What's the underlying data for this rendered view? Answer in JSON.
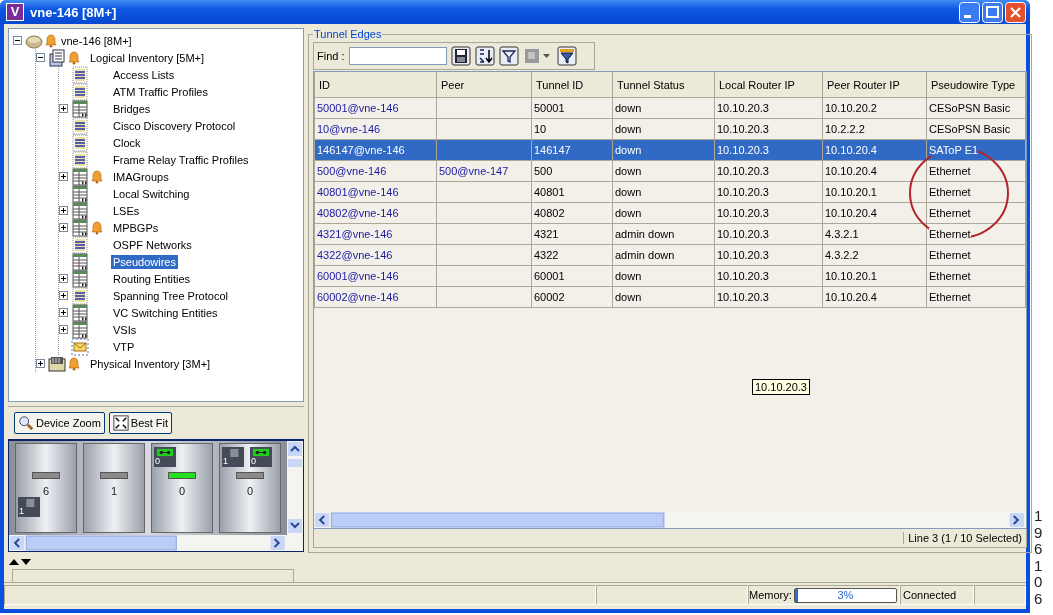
{
  "window": {
    "app_icon_letter": "V",
    "title": "vne-146 [8M+]"
  },
  "tree": [
    {
      "label": "vne-146 [8M+]",
      "kind": "device",
      "alarm": true,
      "expanded": true,
      "selected": false,
      "children": [
        {
          "label": "Logical Inventory [5M+]",
          "kind": "logical",
          "alarm": true,
          "expanded": true,
          "selected": false,
          "children": [
            {
              "label": "Access Lists",
              "kind": "list",
              "alarm": false,
              "selected": false
            },
            {
              "label": "ATM Traffic Profiles",
              "kind": "list",
              "alarm": false,
              "selected": false
            },
            {
              "label": "Bridges",
              "kind": "table",
              "alarm": false,
              "expanded": false,
              "selected": false
            },
            {
              "label": "Cisco Discovery Protocol",
              "kind": "list",
              "alarm": false,
              "selected": false
            },
            {
              "label": "Clock",
              "kind": "list",
              "alarm": false,
              "selected": false
            },
            {
              "label": "Frame Relay Traffic Profiles",
              "kind": "list",
              "alarm": false,
              "selected": false
            },
            {
              "label": "IMAGroups",
              "kind": "table",
              "alarm": true,
              "expanded": false,
              "selected": false
            },
            {
              "label": "Local Switching",
              "kind": "table",
              "alarm": false,
              "selected": false
            },
            {
              "label": "LSEs",
              "kind": "table",
              "alarm": false,
              "expanded": false,
              "selected": false
            },
            {
              "label": "MPBGPs",
              "kind": "table",
              "alarm": true,
              "expanded": false,
              "selected": false
            },
            {
              "label": "OSPF Networks",
              "kind": "list",
              "alarm": false,
              "selected": false
            },
            {
              "label": "Pseudowires",
              "kind": "table",
              "alarm": false,
              "selected": true
            },
            {
              "label": "Routing Entities",
              "kind": "table",
              "alarm": false,
              "expanded": false,
              "selected": false
            },
            {
              "label": "Spanning Tree Protocol",
              "kind": "list",
              "alarm": false,
              "expanded": false,
              "selected": false
            },
            {
              "label": "VC Switching Entities",
              "kind": "table",
              "alarm": false,
              "expanded": false,
              "selected": false
            },
            {
              "label": "VSIs",
              "kind": "table",
              "alarm": false,
              "expanded": false,
              "selected": false
            },
            {
              "label": "VTP",
              "kind": "envelope",
              "alarm": false,
              "selected": false
            }
          ]
        },
        {
          "label": "Physical Inventory [3M+]",
          "kind": "physical",
          "alarm": true,
          "expanded": false,
          "selected": false
        }
      ]
    }
  ],
  "device_view": {
    "buttons": [
      {
        "label": "Device Zoom",
        "kind": "zoom"
      },
      {
        "label": "Best Fit",
        "kind": "fit"
      }
    ],
    "slots": [
      {
        "label": "6",
        "led_on": false,
        "bottom_ports": [
          {
            "label": "1",
            "kind": "square"
          }
        ]
      },
      {
        "label": "1",
        "led_on": false
      },
      {
        "label": "0",
        "led_on": true,
        "top_ports": [
          {
            "label": "0",
            "kind": "link"
          }
        ]
      },
      {
        "label": "0",
        "led_on": false,
        "top_ports": [
          {
            "label": "1",
            "kind": "square"
          },
          {
            "label": "0",
            "kind": "link"
          }
        ]
      }
    ]
  },
  "tunnel_edges": {
    "title": "Tunnel Edges",
    "find_label": "Find :",
    "columns": [
      {
        "label": "ID",
        "kind": "link"
      },
      {
        "label": "Peer",
        "kind": "link"
      },
      {
        "label": "Tunnel ID",
        "kind": "text"
      },
      {
        "label": "Tunnel Status",
        "kind": "text"
      },
      {
        "label": "Local Router IP",
        "kind": "text"
      },
      {
        "label": "Peer Router IP",
        "kind": "text"
      },
      {
        "label": "Pseudowire Type",
        "kind": "text"
      }
    ],
    "rows": [
      {
        "selected": false,
        "cells": [
          "50001@vne-146",
          "",
          "50001",
          "down",
          "10.10.20.3",
          "10.10.20.2",
          "CESoPSN Basic"
        ]
      },
      {
        "selected": false,
        "cells": [
          "10@vne-146",
          "",
          "10",
          "down",
          "10.10.20.3",
          "10.2.2.2",
          "CESoPSN Basic"
        ]
      },
      {
        "selected": true,
        "cells": [
          "146147@vne-146",
          "",
          "146147",
          "down",
          "10.10.20.3",
          "10.10.20.4",
          "SAToP E1"
        ]
      },
      {
        "selected": false,
        "cells": [
          "500@vne-146",
          "500@vne-147",
          "500",
          "down",
          "10.10.20.3",
          "10.10.20.4",
          "Ethernet"
        ]
      },
      {
        "selected": false,
        "cells": [
          "40801@vne-146",
          "",
          "40801",
          "down",
          "10.10.20.3",
          "10.10.20.1",
          "Ethernet"
        ]
      },
      {
        "selected": false,
        "cells": [
          "40802@vne-146",
          "",
          "40802",
          "down",
          "10.10.20.3",
          "10.10.20.4",
          "Ethernet"
        ]
      },
      {
        "selected": false,
        "cells": [
          "4321@vne-146",
          "",
          "4321",
          "admin down",
          "10.10.20.3",
          "4.3.2.1",
          "Ethernet"
        ]
      },
      {
        "selected": false,
        "cells": [
          "4322@vne-146",
          "",
          "4322",
          "admin down",
          "10.10.20.3",
          "4.3.2.2",
          "Ethernet"
        ]
      },
      {
        "selected": false,
        "cells": [
          "60001@vne-146",
          "",
          "60001",
          "down",
          "10.10.20.3",
          "10.10.20.1",
          "Ethernet"
        ]
      },
      {
        "selected": false,
        "cells": [
          "60002@vne-146",
          "",
          "60002",
          "down",
          "10.10.20.3",
          "10.10.20.4",
          "Ethernet"
        ]
      }
    ],
    "tooltip": "10.10.20.3",
    "status": "Line 3 (1 / 10 Selected)"
  },
  "status_bar": {
    "memory_label": "Memory:",
    "memory": {
      "level": 0.03,
      "reading": "3%"
    },
    "connection": "Connected"
  },
  "figure_number": "196106"
}
